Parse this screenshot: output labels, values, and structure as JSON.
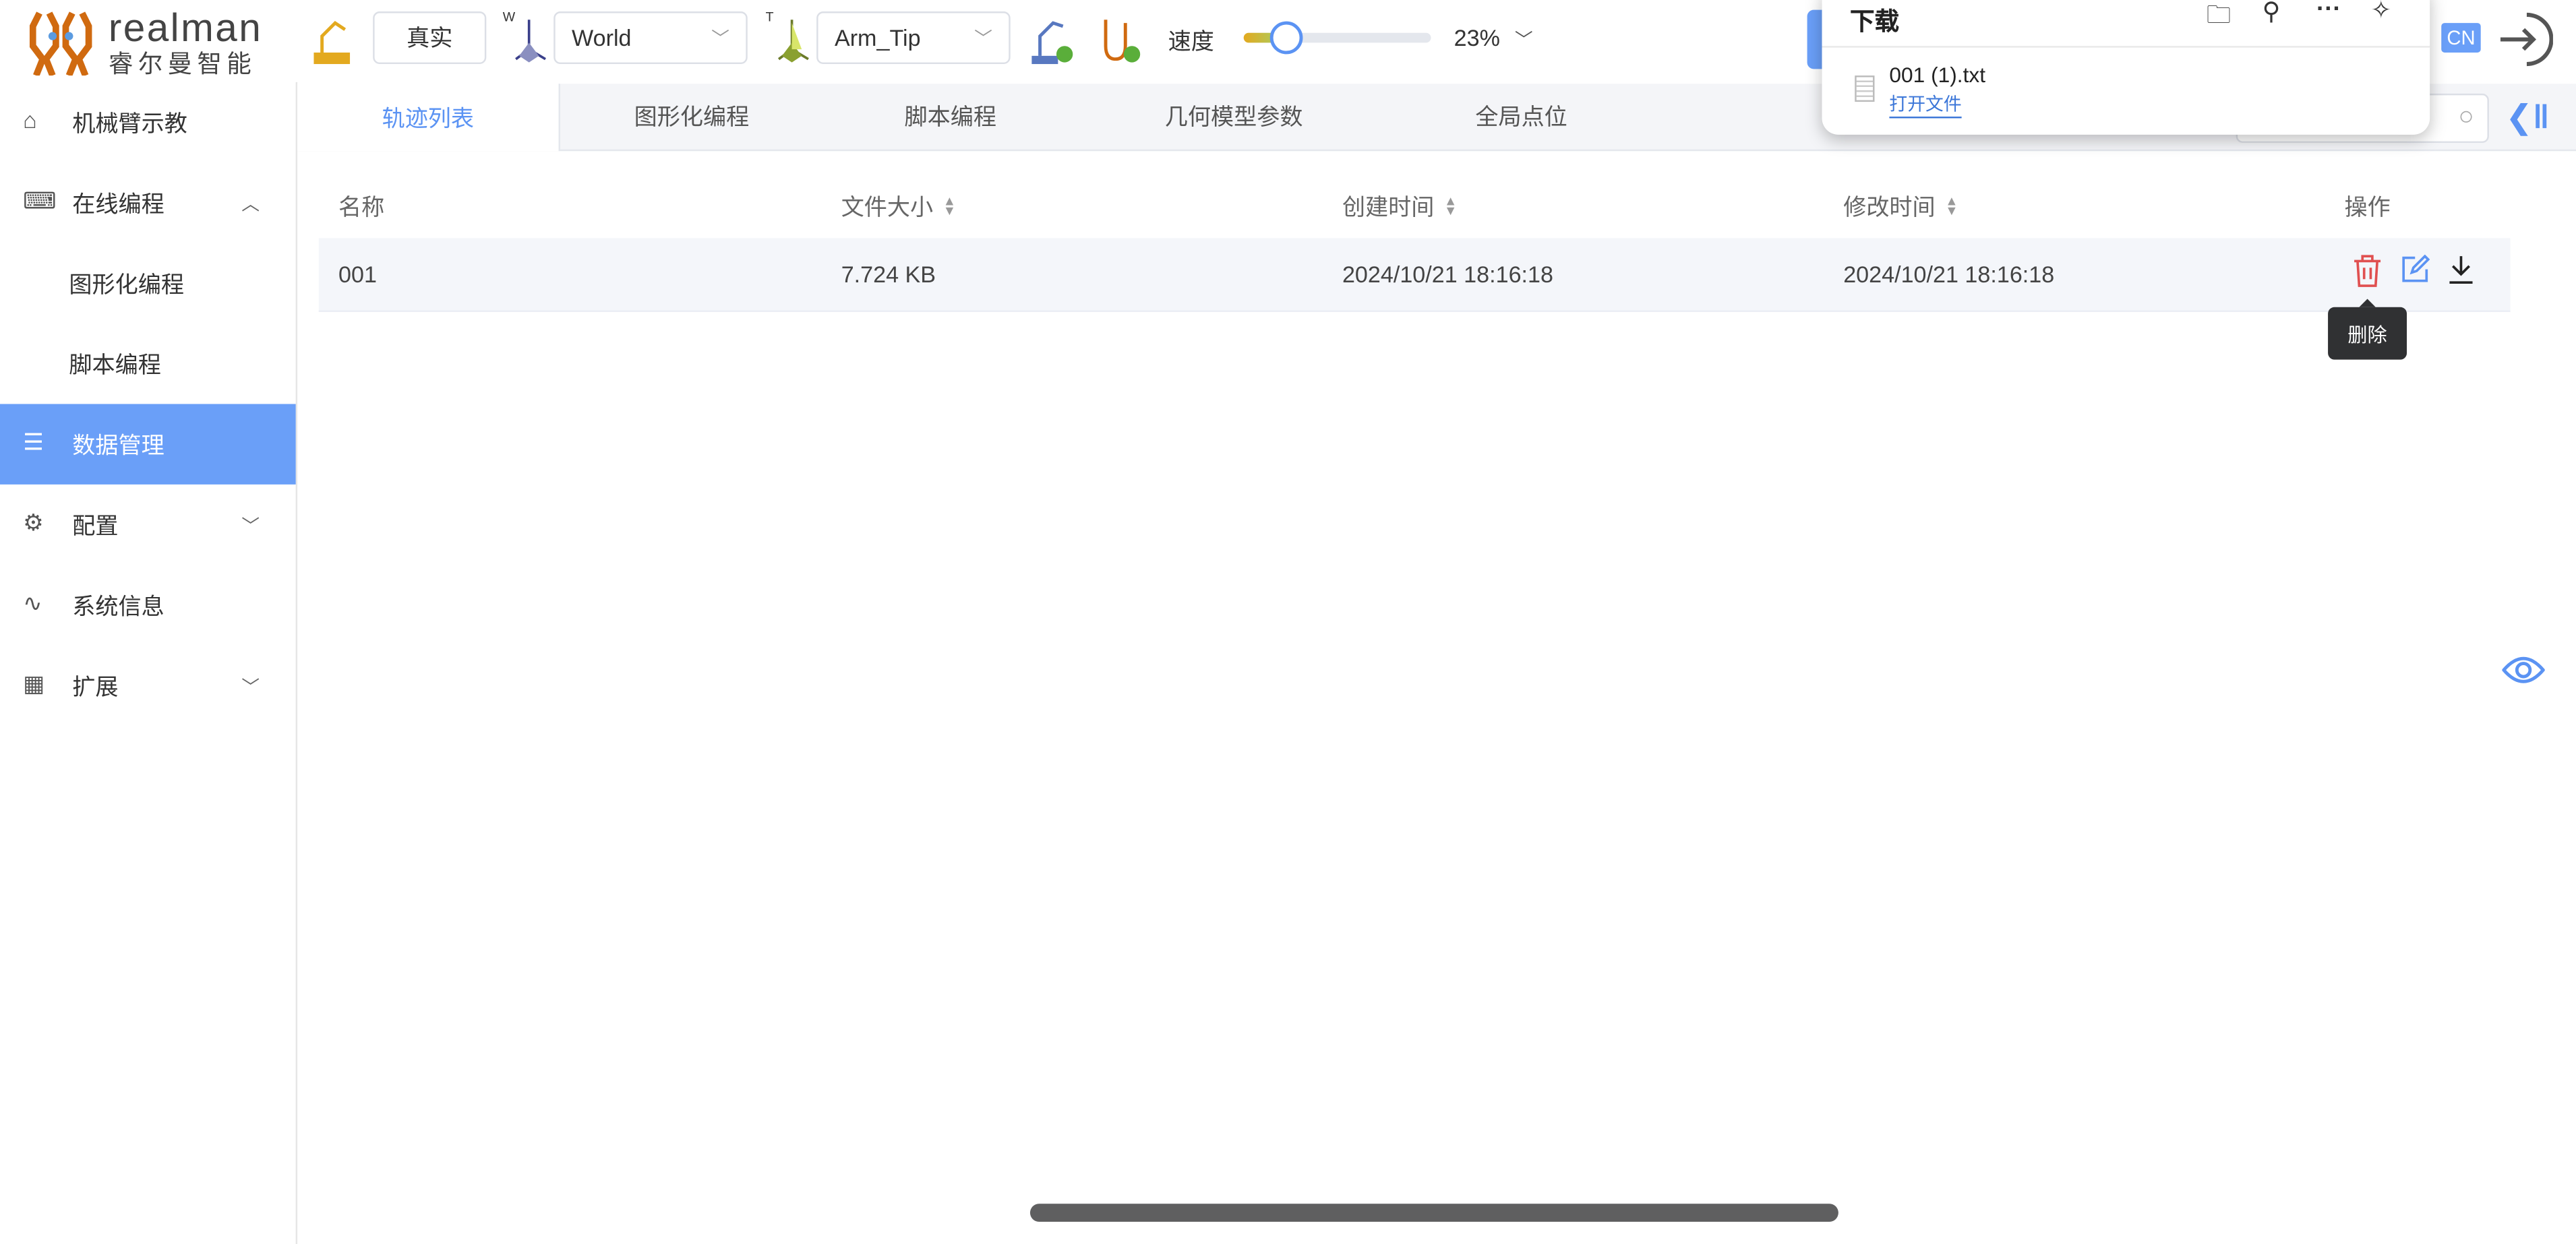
{
  "logo": {
    "brand": "realman",
    "brand_cn": "睿尔曼智能"
  },
  "toolbar": {
    "mode_label": "真实",
    "work_frame": "World",
    "work_frame_axis_label": "W",
    "tool_frame": "Arm_Tip",
    "tool_frame_axis_label": "T",
    "speed_label": "速度",
    "speed_percent": 23,
    "speed_text": "23%",
    "lang_label": "CN"
  },
  "sidebar": {
    "items": [
      {
        "label": "机械臂示教",
        "icon": "home-icon"
      },
      {
        "label": "在线编程",
        "icon": "code-monitor-icon",
        "expanded": true
      },
      {
        "label": "图形化编程",
        "sub": true
      },
      {
        "label": "脚本编程",
        "sub": true
      },
      {
        "label": "数据管理",
        "icon": "database-icon",
        "active": true
      },
      {
        "label": "配置",
        "icon": "gear-icon"
      },
      {
        "label": "系统信息",
        "icon": "pulse-icon"
      },
      {
        "label": "扩展",
        "icon": "grid-icon"
      }
    ]
  },
  "tabs": [
    {
      "label": "轨迹列表",
      "active": true
    },
    {
      "label": "图形化编程"
    },
    {
      "label": "脚本编程"
    },
    {
      "label": "几何模型参数"
    },
    {
      "label": "全局点位"
    }
  ],
  "table": {
    "headers": [
      "名称",
      "文件大小",
      "创建时间",
      "修改时间",
      "操作"
    ],
    "rows": [
      {
        "name": "001",
        "size": "7.724 KB",
        "created": "2024/10/21 18:16:18",
        "modified": "2024/10/21 18:16:18"
      }
    ]
  },
  "tooltip": "删除",
  "downloads": {
    "title": "下载",
    "file": "001 (1).txt",
    "open_label": "打开文件"
  },
  "colors": {
    "accent": "#6a9ff8",
    "delete": "#e05050",
    "tooltip_bg": "#303133"
  }
}
